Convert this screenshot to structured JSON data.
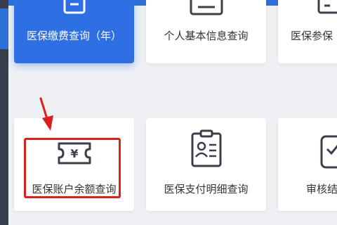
{
  "cards": [
    {
      "label": "医保缴费查询（年）",
      "icon": "document-icon",
      "state": "selected"
    },
    {
      "label": "个人基本信息查询",
      "icon": "id-card-icon"
    },
    {
      "label": "医保参保",
      "icon": "document-icon"
    },
    {
      "label": "医保账户余额查询",
      "icon": "yen-ticket-icon",
      "highlighted": true
    },
    {
      "label": "医保支付明细查询",
      "icon": "clipboard-person-icon"
    },
    {
      "label": "审核结",
      "icon": "clipboard-check-icon"
    }
  ],
  "colors": {
    "primary": "#2f6fe4",
    "highlight": "#d9221c",
    "icon_stroke": "#3a3f4a"
  }
}
